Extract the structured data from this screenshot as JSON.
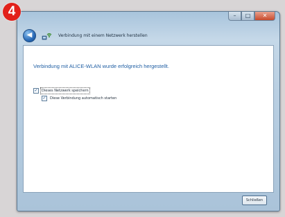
{
  "step": {
    "number": "4",
    "color": "#e2211a"
  },
  "window": {
    "title": "Verbindung mit einem Netzwerk herstellen",
    "controls": {
      "minimize": "–",
      "maximize": "□",
      "close": "✕"
    },
    "back_icon": "back-arrow-icon",
    "network_icon": "network-connection-icon"
  },
  "content": {
    "heading": "Verbindung mit ALICE-WLAN wurde erfolgreich hergestellt.",
    "options": [
      {
        "label": "Dieses Netzwerk speichern",
        "checked": true
      },
      {
        "label": "Diese Verbindung automatisch starten",
        "checked": true
      }
    ]
  },
  "footer": {
    "close_label": "Schließen"
  },
  "colors": {
    "heading": "#1f5ea3",
    "frame": "#b9cfe2"
  }
}
